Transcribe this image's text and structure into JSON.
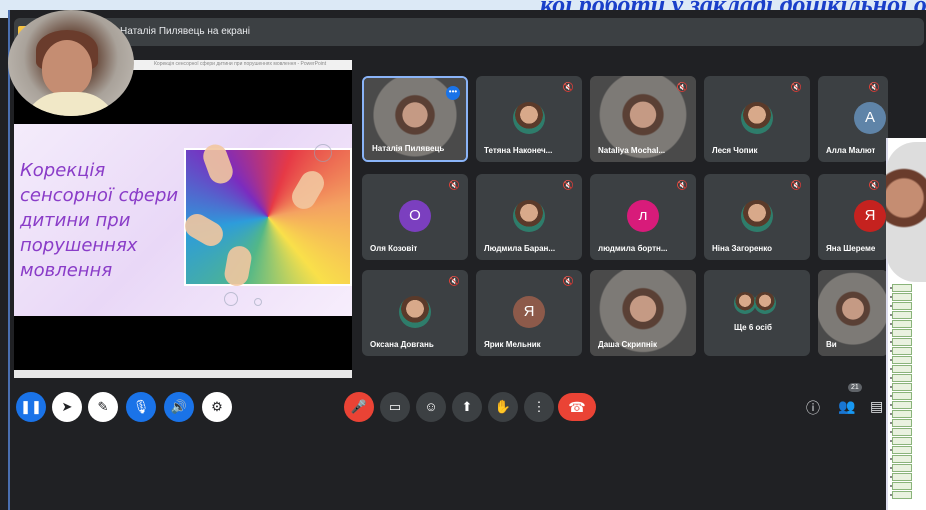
{
  "caption": {
    "text": "кої роботи у закладі дошкільної осв"
  },
  "meet": {
    "presenting_label": "Наталія Пилявець на екрані",
    "slide": {
      "window_title": "Корекція сенсорної сфери дитини при порушеннях мовлення - PowerPoint",
      "title": "Корекція\nсенсорної сфери\nдитини при\nпорушеннях\nмовлення"
    },
    "participants": [
      {
        "name": "Наталія Пилявець",
        "type": "video",
        "active": true,
        "muted": false
      },
      {
        "name": "Тетяна Наконеч...",
        "type": "photo",
        "muted": true
      },
      {
        "name": "Nataliya Mochal...",
        "type": "video",
        "muted": true
      },
      {
        "name": "Леся Чопик",
        "type": "photo",
        "muted": true
      },
      {
        "name": "Алла Малют",
        "type": "letter",
        "letter": "А",
        "color": "#5f84a8",
        "muted": true
      },
      {
        "name": "Оля Козовіт",
        "type": "letter",
        "letter": "О",
        "color": "#7b3fbf",
        "muted": true
      },
      {
        "name": "Людмила Баран...",
        "type": "photo",
        "muted": true
      },
      {
        "name": "людмила бортн...",
        "type": "letter",
        "letter": "л",
        "color": "#d81b7a",
        "muted": true
      },
      {
        "name": "Ніна Загоренко",
        "type": "photo",
        "muted": true
      },
      {
        "name": "Яна Шереме",
        "type": "letter",
        "letter": "Я",
        "color": "#c5221f",
        "muted": true
      },
      {
        "name": "Оксана Довгань",
        "type": "photo",
        "muted": true
      },
      {
        "name": "Ярик Мельник",
        "type": "letter",
        "letter": "Я",
        "color": "#8d5a4a",
        "muted": true
      },
      {
        "name": "Даша Скрипнік",
        "type": "video",
        "muted": false
      },
      {
        "name": "Ще 6 осіб",
        "type": "more",
        "muted": false
      },
      {
        "name": "Ви",
        "type": "video",
        "muted": false
      }
    ],
    "participant_count": "21",
    "icons": {
      "pause": "pause-icon",
      "pointer": "pointer-icon",
      "pen": "pen-icon",
      "mic": "mic-icon",
      "speaker": "speaker-icon",
      "settings": "gear-icon",
      "mic_off": "mic-off-icon",
      "camera": "camera-icon",
      "emoji": "emoji-icon",
      "present": "present-icon",
      "hand": "raise-hand-icon",
      "more": "more-vert-icon",
      "end_call": "end-call-icon",
      "info": "info-icon",
      "people": "people-icon",
      "chat": "chat-icon"
    }
  },
  "colors": {
    "meet_bg": "#202124",
    "tile_bg": "#3c4043",
    "accent_blue": "#1a73e8",
    "end_red": "#ea4335",
    "slide_text": "#8a3cc8",
    "caption": "#1a3fc9"
  }
}
